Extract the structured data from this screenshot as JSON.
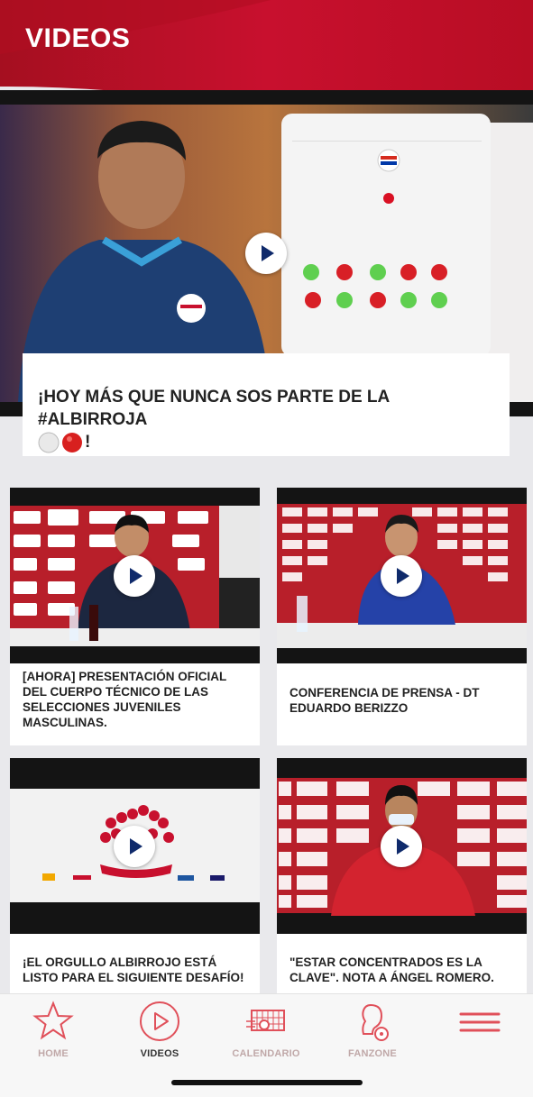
{
  "header": {
    "title": "VIDEOS"
  },
  "featured": {
    "title": "¡HOY MÁS QUE NUNCA SOS PARTE DE LA #ALBIRROJA",
    "title_suffix": "!"
  },
  "videos": [
    {
      "title": "[AHORA] PRESENTACIÓN OFICIAL DEL CUERPO TÉCNICO DE LAS SELECCIONES JUVENILES MASCULINAS."
    },
    {
      "title": "CONFERENCIA DE PRENSA - DT EDUARDO BERIZZO"
    },
    {
      "title": "¡EL ORGULLO ALBIRROJO ESTÁ LISTO PARA EL SIGUIENTE DESAFÍO!"
    },
    {
      "title": "\"ESTAR CONCENTRADOS ES LA CLAVE\". NOTA A ÁNGEL ROMERO."
    }
  ],
  "nav": [
    {
      "label": "HOME",
      "icon": "star-icon"
    },
    {
      "label": "VIDEOS",
      "icon": "play-circle-icon",
      "active": true
    },
    {
      "label": "CALENDARIO",
      "icon": "goal-calendar-icon"
    },
    {
      "label": "FANZONE",
      "icon": "fan-icon"
    },
    {
      "label": "",
      "icon": "hamburger-menu-icon"
    }
  ],
  "colors": {
    "brand_red": "#c8102e",
    "dark_red": "#9b0f1f",
    "nav_icon": "#d9404a"
  }
}
